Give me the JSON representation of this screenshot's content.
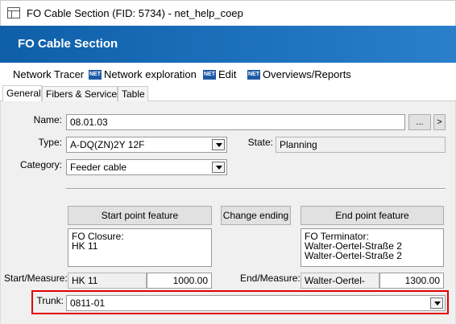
{
  "window": {
    "title": "FO Cable Section (FID: 5734) - net_help_coep"
  },
  "banner": {
    "title": "FO Cable Section"
  },
  "menu": {
    "items": [
      {
        "label": "Network Tracer",
        "icon": null
      },
      {
        "label": "Network exploration",
        "icon": "NET"
      },
      {
        "label": "Edit",
        "icon": "NET"
      },
      {
        "label": "Overviews/Reports",
        "icon": "NET"
      }
    ]
  },
  "tabs": [
    {
      "label": "General",
      "active": true
    },
    {
      "label": "Fibers & Services",
      "active": false
    },
    {
      "label": "Table",
      "active": false
    }
  ],
  "form": {
    "name_label": "Name:",
    "name_value": "08.01.03",
    "ellipsis_label": "...",
    "next_label": ">",
    "type_label": "Type:",
    "type_value": "A-DQ(ZN)2Y 12F",
    "state_label": "State:",
    "state_value": "Planning",
    "category_label": "Category:",
    "category_value": "Feeder cable",
    "start_button": "Start point feature",
    "change_button": "Change ending",
    "end_button": "End point feature",
    "start_memo": "FO Closure:\nHK 11",
    "end_memo": "FO Terminator:\nWalter-Oertel-Straße 2\nWalter-Oertel-Straße 2",
    "start_measure_label": "Start/Measure:",
    "start_name": "HK 11",
    "start_measure": "1000.00",
    "end_measure_label": "End/Measure:",
    "end_name": "Walter-Oertel-",
    "end_measure": "1300.00",
    "trunk_label": "Trunk:",
    "trunk_value": "0811-01"
  },
  "colors": {
    "banner": "#0e5fa8",
    "highlight": "#e00000"
  }
}
